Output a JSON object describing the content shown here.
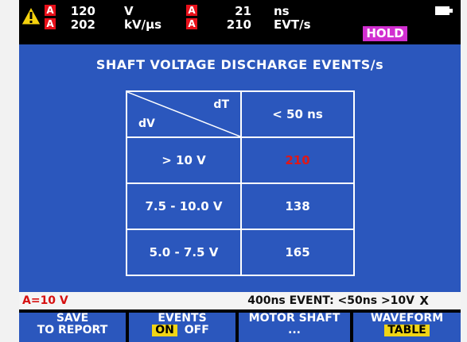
{
  "topbar": {
    "channel_a": "A",
    "row1": {
      "value1": "120",
      "unit1": "V",
      "value2": "21",
      "unit2": "ns"
    },
    "row2": {
      "value1": "202",
      "unit1": "kV/µs",
      "value2": "210",
      "unit2": "EVT/s"
    },
    "hold": "HOLD"
  },
  "title": "SHAFT VOLTAGE DISCHARGE EVENTS/s",
  "table": {
    "header": {
      "dT": "dT",
      "dV": "dV",
      "col": "< 50 ns"
    },
    "rows": [
      {
        "range": "> 10 V",
        "value": "210",
        "color": "#e01818"
      },
      {
        "range": "7.5 - 10.0 V",
        "value": "138"
      },
      {
        "range": "5.0 - 7.5 V",
        "value": "165"
      }
    ]
  },
  "status": {
    "range": "A=10 V",
    "event": "400ns  EVENT: <50ns >10V",
    "x": "X"
  },
  "softkeys": {
    "save": {
      "line1": "SAVE",
      "line2": "TO REPORT"
    },
    "events": {
      "line1": "EVENTS",
      "on": "ON",
      "off": "OFF"
    },
    "motor": {
      "line1": "MOTOR SHAFT",
      "line2": "..."
    },
    "waveform": {
      "line1": "WAVEFORM",
      "line2": "TABLE"
    }
  },
  "colors": {
    "screen_blue": "#2b57bd",
    "alert_red": "#e01818",
    "hold_magenta": "#d12fd0",
    "softkey_yellow": "#f1d515"
  },
  "icons": {
    "warning": "warning-triangle-icon",
    "battery": "battery-icon"
  }
}
